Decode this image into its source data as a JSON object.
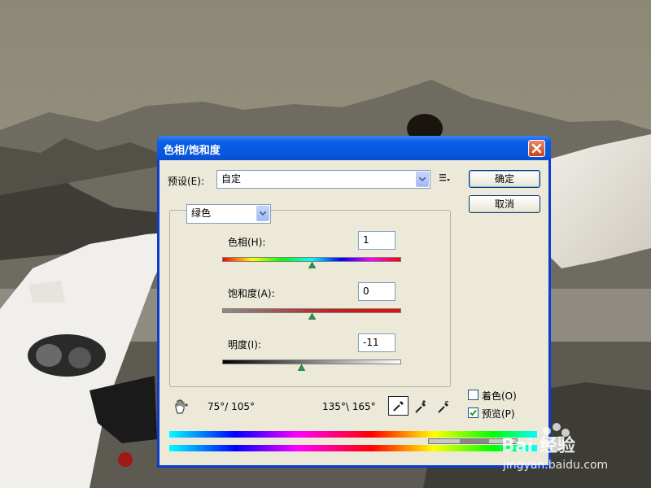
{
  "dialog": {
    "title": "色相/饱和度",
    "preset_label": "预设(E):",
    "preset_value": "自定",
    "ok_label": "确定",
    "cancel_label": "取消",
    "channel_value": "绿色",
    "hue": {
      "label": "色相(H):",
      "value": "1",
      "level": 0.5
    },
    "saturation": {
      "label": "饱和度(A):",
      "value": "0",
      "level": 0.5
    },
    "lightness": {
      "label": "明度(I):",
      "value": "-11",
      "level": 0.445
    },
    "range_left": "75°/ 105°",
    "range_right": "135°\\ 165°",
    "colorize_label": "着色(O)",
    "colorize_checked": false,
    "preview_label": "预览(P)",
    "preview_checked": true
  },
  "icons": {
    "close": "close-icon",
    "preset_menu": "preset-options-icon",
    "hand": "hand-adjust-icon",
    "eyedropper": "eyedropper-icon",
    "eyedropper_plus": "eyedropper-plus-icon",
    "eyedropper_minus": "eyedropper-minus-icon"
  },
  "watermark": {
    "brand": "Bai 经验",
    "url": "jingyan.baidu.com"
  },
  "colors": {
    "title_bar": "#0a5ee8",
    "dialog_face": "#ece9d8",
    "close_button": "#d9542b"
  }
}
